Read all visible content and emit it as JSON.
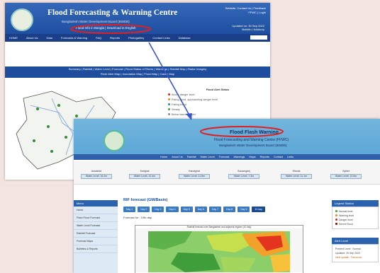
{
  "back": {
    "title": "Flood Forecasting & Warning Centre",
    "subtitle": "Bangladesh Water Development Board (BWDB)",
    "lang": "Flood Info in Bangla | Download in English",
    "top_right": [
      "Website: Contact Us | Feedback",
      "FFWC | Login"
    ],
    "alert": [
      "Updated on: 30 Sep 2022",
      "Bulletin / Advisory"
    ],
    "nav": [
      "HOME",
      "About Us",
      "Data",
      "Forecasts & Warning",
      "FAQ",
      "Reports",
      "Photogallery",
      "Contact Links",
      "Database"
    ],
    "bar_row1": "Summary | Rainfall | Water Level | Forecast | Flood Status of Rivers | Warnings | Rainfall Map | Radar Imagery",
    "bar_row2": "River Alert Map | Inundation Map | Flood Map | Cause Map",
    "legend_title": "Flood Alert Status",
    "legend": [
      "Above danger level",
      "Rising trend, approaching danger level",
      "Falling trend",
      "Steady",
      "Below warning level"
    ]
  },
  "front": {
    "title": "Flood Flash Warning",
    "subtitle": "Flood Forecasting and Warning Centre (FFWC)",
    "org": "Bangladesh Water Development Board (BWDB)",
    "nav": [
      "Home",
      "About Us",
      "Rainfall",
      "Water Level",
      "Forecast",
      "Warnings",
      "Maps",
      "Reports",
      "Contact",
      "Links"
    ],
    "stations": [
      {
        "name": "Amalshid",
        "value": "Water Level: 16.2m"
      },
      {
        "name": "Sarighat",
        "value": "Water Level: 12.4m"
      },
      {
        "name": "Kanaighat",
        "value": "Water Level: 11.8m"
      },
      {
        "name": "Sunamganj",
        "value": "Water Level: 7.3m"
      },
      {
        "name": "Sheola",
        "value": "Water Level: 11.1m"
      },
      {
        "name": "Sylhet",
        "value": "Water Level: 10.5m"
      }
    ],
    "side_header": "Menu",
    "side_items": [
      "Home",
      "Flash Flood Forecast",
      "Water Level Forecast",
      "Rainfall Forecast",
      "Forecast Maps",
      "Bulletins & Reports"
    ],
    "main_title": "RIF forecast (GM/Basin)",
    "tabs": [
      "Day 1",
      "Day 2",
      "Day 3",
      "Day 4",
      "Day 5",
      "Day 6",
      "Day 7",
      "Day 8",
      "Day 9",
      "10 day"
    ],
    "active_tab": "10 day",
    "forecast_label": "Forecast for : 10th day",
    "map_title": "Rainfall forecast over Bangladesh and adjacent regions (10 day)",
    "right1_header": "Legend Station",
    "right1_items": [
      "Normal level",
      "Warning level",
      "Danger level",
      "Severe flood"
    ],
    "right2_header": "Alert Level",
    "right2_items": [
      "Present Level : Normal",
      "Updated: 20 Sep 2022",
      "Next update : Tomorrow"
    ],
    "colors": {
      "accent": "#2b62ad",
      "annotation": "#e02020",
      "arrow": "#3a55c8"
    }
  }
}
